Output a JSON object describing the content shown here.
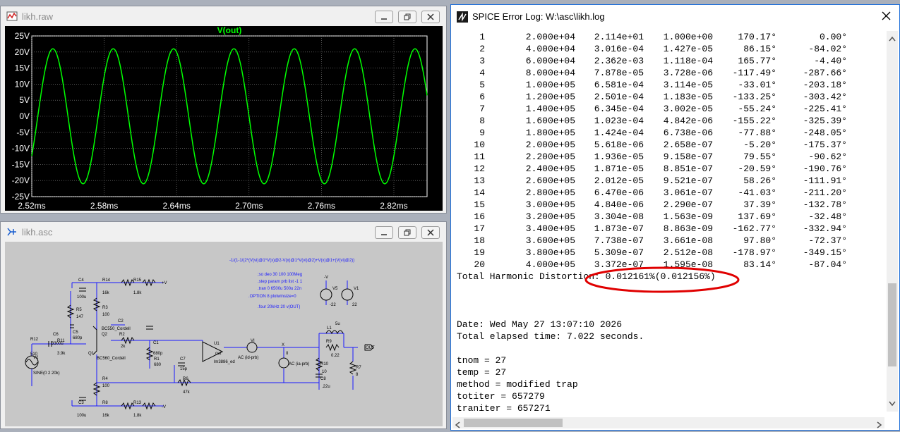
{
  "waveform_window": {
    "title": "likh.raw",
    "trace_label": "V(out)",
    "colors": {
      "trace": "#00ff00",
      "grid": "#8a8a8a",
      "axis_text": "#ffffff"
    },
    "chart_data": {
      "type": "line",
      "title": "V(out)",
      "xlabel": "",
      "ylabel": "",
      "x_ticks": [
        "2.52ms",
        "2.58ms",
        "2.64ms",
        "2.70ms",
        "2.76ms",
        "2.82ms"
      ],
      "y_ticks": [
        "25V",
        "20V",
        "15V",
        "10V",
        "5V",
        "0V",
        "-5V",
        "-10V",
        "-15V",
        "-20V",
        "-25V"
      ],
      "xlim": [
        2.52,
        2.8475
      ],
      "ylim": [
        -25,
        25
      ],
      "series": [
        {
          "name": "V(out)",
          "amplitude": 21,
          "frequency_hz": 20000,
          "phase_deg": 0
        }
      ],
      "grid": true
    }
  },
  "schematic_window": {
    "title": "likh.asc",
    "directives": [
      "-1/(1-1/(2*(V(vi)@1*V(x)@2-V(x)@1*V(vi)@2)+V(x)@1+(V(vi)@2))",
      ";so deo 30 100 100Meg",
      ".step param prb list -1 1",
      ".tran 0 6500u 500u 22n",
      ".OPTION 8 plotwinsize=0",
      ".four 20kHz 20 v(OUT)"
    ],
    "labels": {
      "c4": "C4",
      "c4v": "100u",
      "r14": "R14",
      "r14v": "16k",
      "r15": "R15",
      "r15v": "1.8k",
      "r3": "R3",
      "r3v": "100",
      "r5": "R5",
      "r5v": "147",
      "c5": "C5",
      "c5v": "680p",
      "c2": "C2",
      "q2": "Q2",
      "q2m": "BC550_Cordell",
      "q1": "Q1",
      "q1m": "BC560_Cordell",
      "r2": "R2",
      "r2v": "2k",
      "c1": "C1",
      "c1v": "680p",
      "r1": "R1",
      "r1v": "680",
      "c7": "C7",
      "c7v": "15p",
      "r6": "R6",
      "r6v": "47k",
      "r4": "R4",
      "r4v": "100",
      "r12": "R12",
      "r12v": "510",
      "c6": "C6",
      "c6v": "3300u",
      "r11": "R11",
      "r11v": "3.9k",
      "v2": "V2",
      "v2v": "SINE(0 2 20k)",
      "c3": "C3",
      "c3v": "100u",
      "r8": "R8",
      "r8v": "16k",
      "r13": "R13",
      "r13v": "1.8k",
      "u1": "U1",
      "u1m": "lm3886_ed",
      "vi": "VI",
      "vis": "AC (id-prb)",
      "x": "X",
      "ii": "II",
      "iis": "AC (ia-prb)",
      "l1": "L1",
      "l1v": "5u",
      "r9": "R9",
      "r9v": "0.22",
      "r10": "R10",
      "r10v": "10",
      "c8": "C8",
      "c8v": ".22u",
      "r7": "R7",
      "r7v": "8",
      "out": "OUT",
      "v5": "V5",
      "v5v": "-22",
      "v1": "V1",
      "v1v": "22",
      "vneg": "-V",
      "vpos": "+V",
      "vneg2": "-V",
      "out_pin": "out"
    }
  },
  "log_window": {
    "title": "SPICE Error Log: W:\\asc\\likh.log",
    "harmonics": [
      [
        "1",
        "2.000e+04",
        "2.114e+01",
        "1.000e+00",
        "170.17°",
        "0.00°"
      ],
      [
        "2",
        "4.000e+04",
        "3.016e-04",
        "1.427e-05",
        "86.15°",
        "-84.02°"
      ],
      [
        "3",
        "6.000e+04",
        "2.362e-03",
        "1.118e-04",
        "165.77°",
        "-4.40°"
      ],
      [
        "4",
        "8.000e+04",
        "7.878e-05",
        "3.728e-06",
        "-117.49°",
        "-287.66°"
      ],
      [
        "5",
        "1.000e+05",
        "6.581e-04",
        "3.114e-05",
        "-33.01°",
        "-203.18°"
      ],
      [
        "6",
        "1.200e+05",
        "2.501e-04",
        "1.183e-05",
        "-133.25°",
        "-303.42°"
      ],
      [
        "7",
        "1.400e+05",
        "6.345e-04",
        "3.002e-05",
        "-55.24°",
        "-225.41°"
      ],
      [
        "8",
        "1.600e+05",
        "1.023e-04",
        "4.842e-06",
        "-155.22°",
        "-325.39°"
      ],
      [
        "9",
        "1.800e+05",
        "1.424e-04",
        "6.738e-06",
        "-77.88°",
        "-248.05°"
      ],
      [
        "10",
        "2.000e+05",
        "5.618e-06",
        "2.658e-07",
        "-5.20°",
        "-175.37°"
      ],
      [
        "11",
        "2.200e+05",
        "1.936e-05",
        "9.158e-07",
        "79.55°",
        "-90.62°"
      ],
      [
        "12",
        "2.400e+05",
        "1.871e-05",
        "8.851e-07",
        "-20.59°",
        "-190.76°"
      ],
      [
        "13",
        "2.600e+05",
        "2.012e-05",
        "9.521e-07",
        "58.26°",
        "-111.91°"
      ],
      [
        "14",
        "2.800e+05",
        "6.470e-06",
        "3.061e-07",
        "-41.03°",
        "-211.20°"
      ],
      [
        "15",
        "3.000e+05",
        "4.840e-06",
        "2.290e-07",
        "37.39°",
        "-132.78°"
      ],
      [
        "16",
        "3.200e+05",
        "3.304e-08",
        "1.563e-09",
        "137.69°",
        "-32.48°"
      ],
      [
        "17",
        "3.400e+05",
        "1.873e-07",
        "8.863e-09",
        "-162.77°",
        "-332.94°"
      ],
      [
        "18",
        "3.600e+05",
        "7.738e-07",
        "3.661e-08",
        "97.80°",
        "-72.37°"
      ],
      [
        "19",
        "3.800e+05",
        "5.309e-07",
        "2.512e-08",
        "-178.97°",
        "-349.15°"
      ],
      [
        "20",
        "4.000e+05",
        "3.372e-07",
        "1.595e-08",
        "83.14°",
        "-87.04°"
      ]
    ],
    "thd_line": "Total Harmonic Distortion: 0.012161%(0.012156%)",
    "date_line": "Date: Wed May 27 13:07:10 2026",
    "elapsed_line": "Total elapsed time: 7.022 seconds.",
    "tnom_line": "tnom = 27",
    "temp_line": "temp = 27",
    "method_line": "method = modified trap",
    "totiter_line": "totiter = 657279",
    "traniter_line": "traniter = 657271",
    "highlight_color": "#e00000"
  }
}
